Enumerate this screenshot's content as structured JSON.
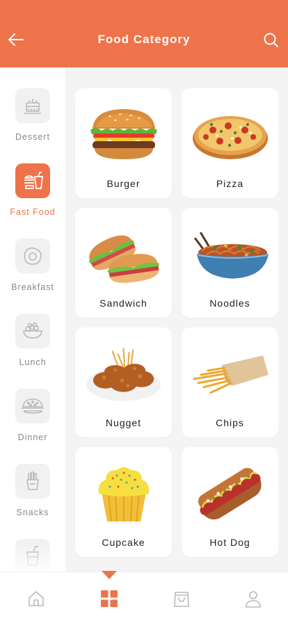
{
  "header": {
    "title": "Food Category"
  },
  "sidebar": {
    "items": [
      {
        "label": "Dessert",
        "icon": "cake-icon",
        "active": false
      },
      {
        "label": "Fast Food",
        "icon": "fast-food-icon",
        "active": true
      },
      {
        "label": "Breakfast",
        "icon": "egg-icon",
        "active": false
      },
      {
        "label": "Lunch",
        "icon": "salad-bowl-icon",
        "active": false
      },
      {
        "label": "Dinner",
        "icon": "dinner-plate-icon",
        "active": false
      },
      {
        "label": "Snacks",
        "icon": "fries-icon",
        "active": false
      },
      {
        "label": "",
        "icon": "drink-cup-icon",
        "active": false
      }
    ]
  },
  "foods": [
    {
      "name": "Burger",
      "image": "burger"
    },
    {
      "name": "Pizza",
      "image": "pizza"
    },
    {
      "name": "Sandwich",
      "image": "sandwich"
    },
    {
      "name": "Noodles",
      "image": "noodles"
    },
    {
      "name": "Nugget",
      "image": "nugget"
    },
    {
      "name": "Chips",
      "image": "chips"
    },
    {
      "name": "Cupcake",
      "image": "cupcake"
    },
    {
      "name": "Hot Dog",
      "image": "hot-dog"
    }
  ],
  "bottom_nav": [
    {
      "icon": "home-icon",
      "active": false
    },
    {
      "icon": "grid-icon",
      "active": true
    },
    {
      "icon": "shopping-bag-icon",
      "active": false
    },
    {
      "icon": "profile-icon",
      "active": false
    }
  ],
  "colors": {
    "accent": "#ee734a",
    "muted": "#888888",
    "icon_gray": "#b9b9b9"
  }
}
